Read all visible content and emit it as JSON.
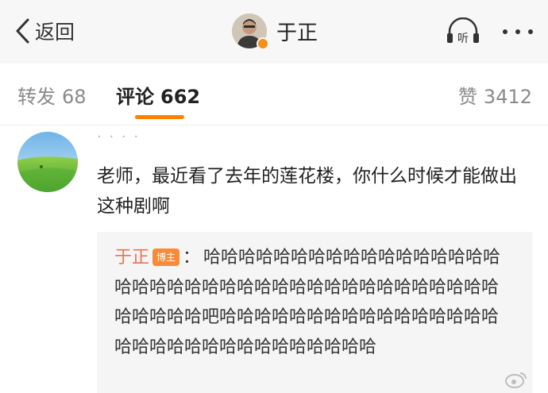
{
  "nav": {
    "back_label": "返回",
    "author_name": "于正",
    "listen_icon": "headphones-listen-icon",
    "listen_label": "听",
    "more_icon": "more-dots-icon"
  },
  "tabs": {
    "repost_label": "转发",
    "repost_count": "68",
    "comments_label": "评论",
    "comments_count": "662",
    "likes_label": "赞",
    "likes_count": "3412"
  },
  "comment": {
    "username": "· · · ·",
    "text": "老师，最近看了去年的莲花楼，你什么时候才能做出这种剧啊",
    "reply": {
      "author": "于正",
      "badge": "博主",
      "separator": "：",
      "text": "哈哈哈哈哈哈哈哈哈哈哈哈哈哈哈哈哈哈哈哈哈哈哈哈哈哈哈哈哈哈哈哈哈哈哈哈哈哈哈哈哈哈哈哈吧哈哈哈哈哈哈哈哈哈哈哈哈哈哈哈哈哈哈哈哈哈哈哈哈哈哈哈哈哈哈哈"
    }
  },
  "colors": {
    "accent": "#ff8200",
    "reply_author": "#eb7350",
    "badge": "#f88a3a",
    "verified": "#f29018"
  }
}
